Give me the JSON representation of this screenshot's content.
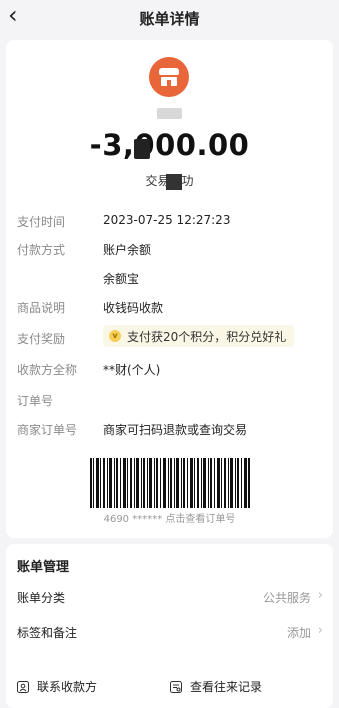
{
  "header": {
    "title": "账单详情",
    "back_icon": "chevron-left-icon"
  },
  "merchant": {
    "name": "■■",
    "logo_icon": "shop-icon",
    "logo_color": "#e8663a"
  },
  "transaction": {
    "amount": "-3,000.00",
    "status": "交易成功"
  },
  "details": {
    "pay_time_label": "支付时间",
    "pay_time": "2023-07-25 12:27:23",
    "pay_method_label": "付款方式",
    "pay_method_1": "账户余额",
    "pay_method_2": "余额宝",
    "product_label": "商品说明",
    "product": "收钱码收款",
    "reward_label": "支付奖励",
    "reward": "支付获20个积分，积分兑好礼",
    "payee_label": "收款方全称",
    "payee": "**财(个人)",
    "order_label": "订单号",
    "order": "",
    "merchant_order_label": "商家订单号",
    "merchant_order": "商家可扫码退款或查询交易"
  },
  "barcode": {
    "caption": "4690 ****** 点击查看订单号"
  },
  "management": {
    "title": "账单管理",
    "category_label": "账单分类",
    "category_value": "公共服务",
    "tags_label": "标签和备注",
    "tags_value": "添加",
    "contact_label": "联系收款方",
    "history_label": "查看往来记录"
  }
}
